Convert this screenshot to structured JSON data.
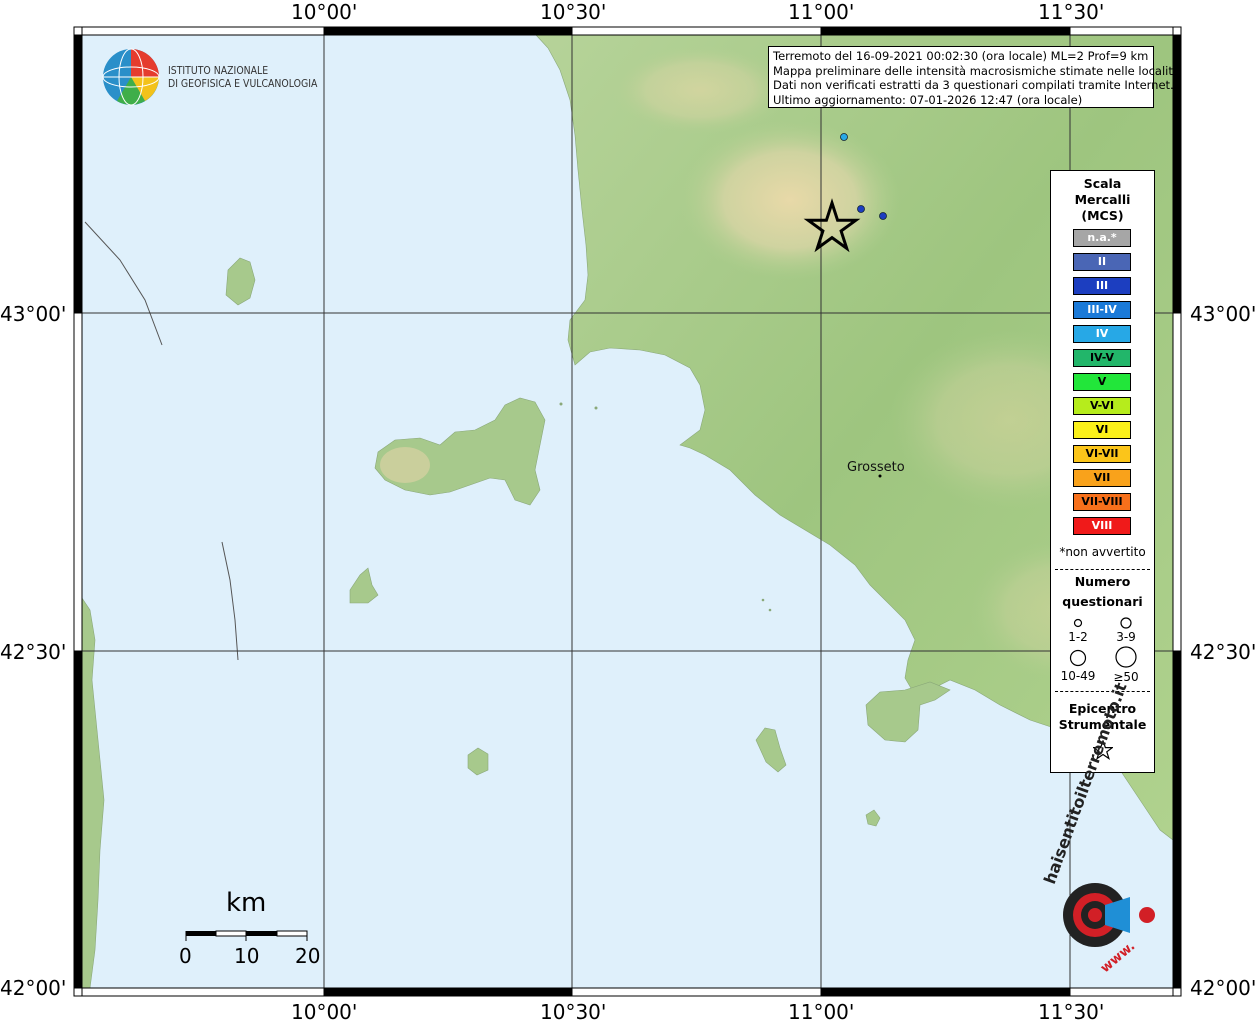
{
  "map": {
    "top_ticks": [
      "10°00'",
      "10°30'",
      "11°00'",
      "11°30'"
    ],
    "bottom_ticks": [
      "10°00'",
      "10°30'",
      "11°00'",
      "11°30'"
    ],
    "left_ticks": [
      "43°00'",
      "42°30'",
      "42°00'"
    ],
    "right_ticks": [
      "43°00'",
      "42°30'",
      "42°00'"
    ],
    "colors": {
      "sea": "#dff0fb",
      "land_low": "#a9cc8e",
      "land_high": "#e3d4a6",
      "grid": "#333333"
    }
  },
  "ingv": {
    "line1": "ISTITUTO NAZIONALE",
    "line2": "DI GEOFISICA E VULCANOLOGIA"
  },
  "info": {
    "line1": "Terremoto del 16-09-2021 00:02:30 (ora locale) ML=2 Prof=9 km",
    "line2": "Mappa preliminare delle intensità macrosismiche stimate nelle località",
    "line3": "Dati non verificati estratti da 3 questionari compilati tramite Internet.",
    "line4": "Ultimo aggiornamento: 07-01-2026 12:47 (ora locale)"
  },
  "legend": {
    "title1": "Scala",
    "title2": "Mercalli",
    "title3": "(MCS)",
    "scale": [
      {
        "label": "n.a.*",
        "color": "#a6a6a6",
        "text_color": "#ffffff"
      },
      {
        "label": "II",
        "color": "#4a66b5",
        "text_color": "#ffffff"
      },
      {
        "label": "III",
        "color": "#1c3ec0",
        "text_color": "#ffffff"
      },
      {
        "label": "III-IV",
        "color": "#1b7ad8",
        "text_color": "#ffffff"
      },
      {
        "label": "IV",
        "color": "#27a8e6",
        "text_color": "#ffffff"
      },
      {
        "label": "IV-V",
        "color": "#22b66a",
        "text_color": "#000000"
      },
      {
        "label": "V",
        "color": "#22e63a",
        "text_color": "#000000"
      },
      {
        "label": "V-VI",
        "color": "#b6ec1c",
        "text_color": "#000000"
      },
      {
        "label": "VI",
        "color": "#fbf11a",
        "text_color": "#000000"
      },
      {
        "label": "VI-VII",
        "color": "#fbc51a",
        "text_color": "#000000"
      },
      {
        "label": "VII",
        "color": "#f9a21b",
        "text_color": "#000000"
      },
      {
        "label": "VII-VIII",
        "color": "#f7701b",
        "text_color": "#000000"
      },
      {
        "label": "VIII",
        "color": "#f01a1a",
        "text_color": "#ffffff"
      }
    ],
    "note": "*non avvertito",
    "questionari_title1": "Numero",
    "questionari_title2": "questionari",
    "q_labels": [
      "1-2",
      "3-9",
      "10-49",
      "≥50"
    ],
    "epicentro1": "Epicentro",
    "epicentro2": "Strumentale"
  },
  "places": [
    {
      "name": "Grosseto"
    }
  ],
  "scalebar": {
    "unit": "km",
    "ticks": [
      "0",
      "10",
      "20"
    ]
  },
  "logo": {
    "text1": "haisentitoilterremoto.it",
    "text2": "www."
  }
}
